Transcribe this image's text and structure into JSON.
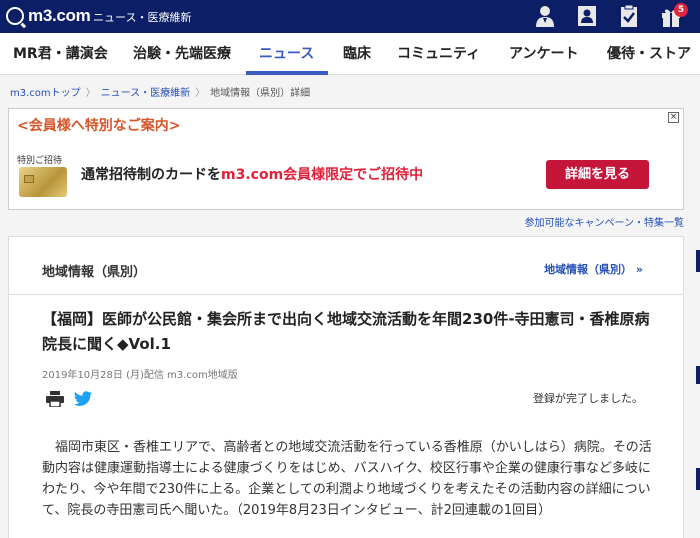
{
  "header": {
    "logo_text": "m3.com",
    "section": "ニュース・医療維新",
    "notification_count": "5",
    "icons": [
      "doctor-icon",
      "person-board-icon",
      "clipboard-check-icon",
      "gift-icon"
    ]
  },
  "nav": {
    "items": [
      "MR君・講演会",
      "治験・先端医療",
      "ニュース",
      "臨床",
      "コミュニティ",
      "アンケート",
      "優待・ストア"
    ],
    "active": "ニュース"
  },
  "breadcrumb": [
    "m3.comトップ",
    "ニュース・医療維新",
    "地域情報（県別）詳細"
  ],
  "promo": {
    "title": "<会員様へ特別なご案内>",
    "small_label": "特別ご招待",
    "text_before": "通常招待制のカードを",
    "text_highlight": "m3.com会員様限定でご招待中",
    "button": "詳細を見る",
    "close": "×"
  },
  "campaign_link": "参加可能なキャンペーン・特集一覧",
  "section": {
    "title": "地域情報（県別）",
    "link": "地域情報（県別） »"
  },
  "article": {
    "headline": "【福岡】医師が公民館・集会所まで出向く地域交流活動を年間230件-寺田憲司・香椎原病院長に聞く◆Vol.1",
    "meta": "2019年10月28日 (月)配信 m3.com地域版",
    "registered": "登録が完了しました。",
    "body": "福岡市東区・香椎エリアで、高齢者との地域交流活動を行っている香椎原（かいしはら）病院。その活動内容は健康運動指導士による健康づくりをはじめ、バスハイク、校区行事や企業の健康行事など多岐にわたり、今や年間で230件に上る。企業としての利潤より地域づくりを考えたその活動内容の詳細について、院長の寺田憲司氏へ聞いた。（2019年8月23日インタビュー、計2回連載の1回目）"
  },
  "colors": {
    "header_bg": "#0b1e66",
    "accent": "#3a5bbf",
    "promo_button": "#c5163a",
    "highlight": "#e0213a"
  }
}
